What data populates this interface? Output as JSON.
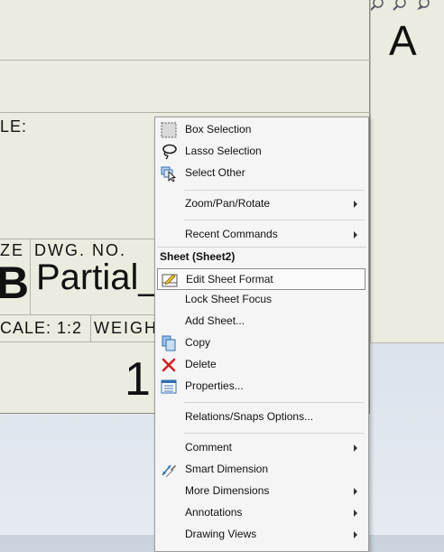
{
  "sheet": {
    "scale_label": "LE:",
    "size_label": "ZE",
    "dwg_no_label": "DWG. NO.",
    "size_value": "B",
    "dwg_no_value": "Partial_",
    "scale_value": "CALE: 1:2",
    "weight_label": "WEIGHT",
    "sheet_number": "1",
    "revision": "A"
  },
  "menu": {
    "items_top": [
      {
        "label": "Box Selection",
        "icon": "box-selection-icon"
      },
      {
        "label": "Lasso Selection",
        "icon": "lasso-selection-icon"
      },
      {
        "label": "Select Other",
        "icon": "select-other-icon"
      }
    ],
    "zoom": {
      "label": "Zoom/Pan/Rotate"
    },
    "recent": {
      "label": "Recent Commands"
    },
    "section_header": "Sheet (Sheet2)",
    "sheet_items": [
      {
        "label": "Edit Sheet Format",
        "icon": "edit-sheet-format-icon"
      },
      {
        "label": "Lock Sheet Focus"
      },
      {
        "label": "Add Sheet..."
      },
      {
        "label": "Copy",
        "icon": "copy-icon"
      },
      {
        "label": "Delete",
        "icon": "delete-icon"
      },
      {
        "label": "Properties...",
        "icon": "properties-icon"
      }
    ],
    "relations": {
      "label": "Relations/Snaps Options..."
    },
    "bottom_items": [
      {
        "label": "Comment"
      },
      {
        "label": "Smart Dimension",
        "icon": "smart-dimension-icon"
      },
      {
        "label": "More Dimensions"
      },
      {
        "label": "Annotations"
      },
      {
        "label": "Drawing Views"
      }
    ]
  },
  "colors": {
    "sheet_bg": "#ecebdf",
    "menu_bg": "#f5f5f5",
    "delete_red": "#d21f1f",
    "icon_blue": "#2f6db5"
  }
}
